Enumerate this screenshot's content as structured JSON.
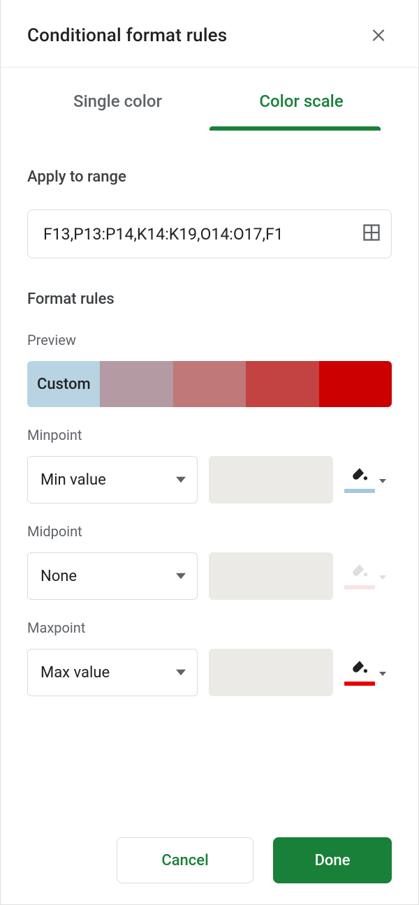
{
  "header": {
    "title": "Conditional format rules"
  },
  "tabs": {
    "single": "Single color",
    "scale": "Color scale"
  },
  "apply": {
    "heading": "Apply to range",
    "range_value": "F13,P13:P14,K14:K19,O14:O17,F1"
  },
  "rules": {
    "heading": "Format rules",
    "preview_label": "Preview",
    "preview_badge": "Custom",
    "gradient_colors": [
      "#b8d4e3",
      "#b49aa2",
      "#c07879",
      "#c34342",
      "#cc0000"
    ]
  },
  "minpoint": {
    "label": "Minpoint",
    "select_value": "Min value",
    "color": "#a4c7de"
  },
  "midpoint": {
    "label": "Midpoint",
    "select_value": "None",
    "color": "#f3c3c7"
  },
  "maxpoint": {
    "label": "Maxpoint",
    "select_value": "Max value",
    "color": "#e60000"
  },
  "footer": {
    "cancel": "Cancel",
    "done": "Done"
  }
}
